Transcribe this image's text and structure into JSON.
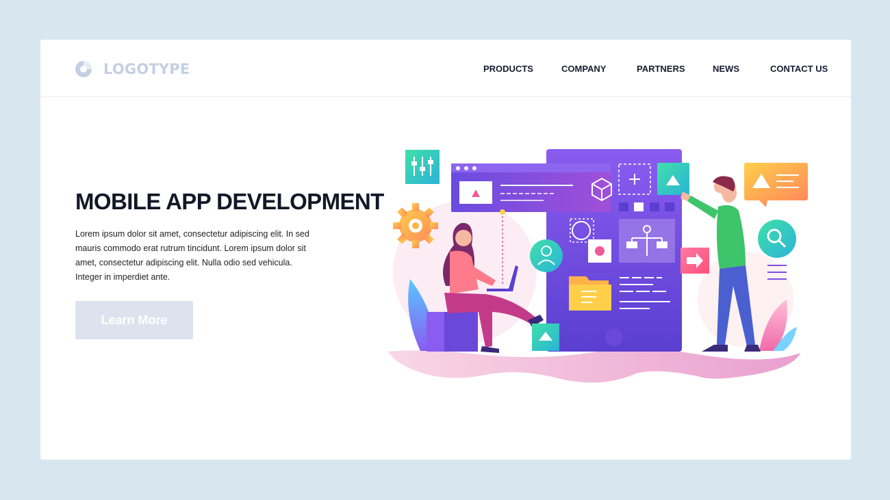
{
  "header": {
    "logo_text": "LOGOTYPE",
    "nav": [
      "PRODUCTS",
      "COMPANY",
      "PARTNERS",
      "NEWS",
      "CONTACT US"
    ]
  },
  "hero": {
    "title": "MOBILE APP DEVELOPMENT",
    "body": "Lorem ipsum dolor sit amet, consectetur adipiscing elit. In sed mauris commodo erat rutrum tincidunt. Lorem ipsum dolor sit amet, consectetur adipiscing elit. Nulla  odio sed vehicula. Integer in imperdiet ante.",
    "cta_label": "Learn More"
  },
  "colors": {
    "background": "#d8e6ef",
    "card": "#ffffff",
    "phone_purple": "#7b4fe0",
    "accent_pink": "#f05a9a",
    "accent_green": "#3dd68c",
    "accent_orange": "#ffb347",
    "cta_bg": "#dde3ee",
    "logo_color": "#c3d0e2"
  },
  "icons": [
    "logo-icon",
    "equalizer-icon",
    "gear-icon",
    "cube-icon",
    "plus-icon",
    "triangle-icon",
    "user-icon",
    "record-icon",
    "folder-icon",
    "flowchart-icon",
    "arrow-right-icon",
    "search-icon",
    "chat-bubble-icon"
  ]
}
